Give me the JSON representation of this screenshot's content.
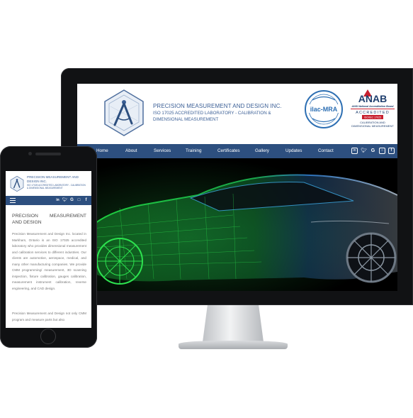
{
  "desktop": {
    "company_name": "PRECISION MEASUREMENT AND DESIGN INC.",
    "company_tagline": "ISO 17025 ACCREDITED LABORATORY - CALIBRATION & DIMENSIONAL MEASUREMENT",
    "ilac_label": "ilac-MRA",
    "anab": {
      "title": "ANAB",
      "subtitle": "ANSI National Accreditation Board",
      "accredited": "ACCREDITED",
      "badge": "ISO/IEC 17025",
      "line1": "CALIBRATION AND",
      "line2": "DIMENSIONAL MEASUREMENT"
    },
    "nav": [
      "Home",
      "About",
      "Services",
      "Training",
      "Certificates",
      "Gallery",
      "Updates",
      "Contact"
    ],
    "social": [
      "in",
      "t",
      "G",
      "ig",
      "f"
    ]
  },
  "mobile": {
    "company_name": "PRECISION MEASUREMENT AND DESIGN INC.",
    "company_tagline": "ISO 17025 ACCREDITED LABORATORY - CALIBRATION & DIMENSIONAL MEASUREMENT",
    "heading": "PRECISION MEASUREMENT AND DESIGN",
    "paragraph1": "Precision Measurement and Design Inc. located in Markham, Ontario is an ISO 17025 accredited laboratory who provides dimensional measurement and calibration services to different industries. Our clients are automotive, aerospace, medical, and many other manufacturing companies. We provide CMM programming/ measurement, 3D scanning inspection, fixture calibration, gauges calibration, measurement instrument calibration, reverse engineering, and CAD design.",
    "paragraph2": "Precision Measurement and Design not only CMM program and measure parts but also"
  },
  "colors": {
    "nav": "#2d4f7f",
    "brand_text": "#3b5f96",
    "hero_green": "#2bd14a",
    "hero_blue": "#2a6fb8"
  }
}
